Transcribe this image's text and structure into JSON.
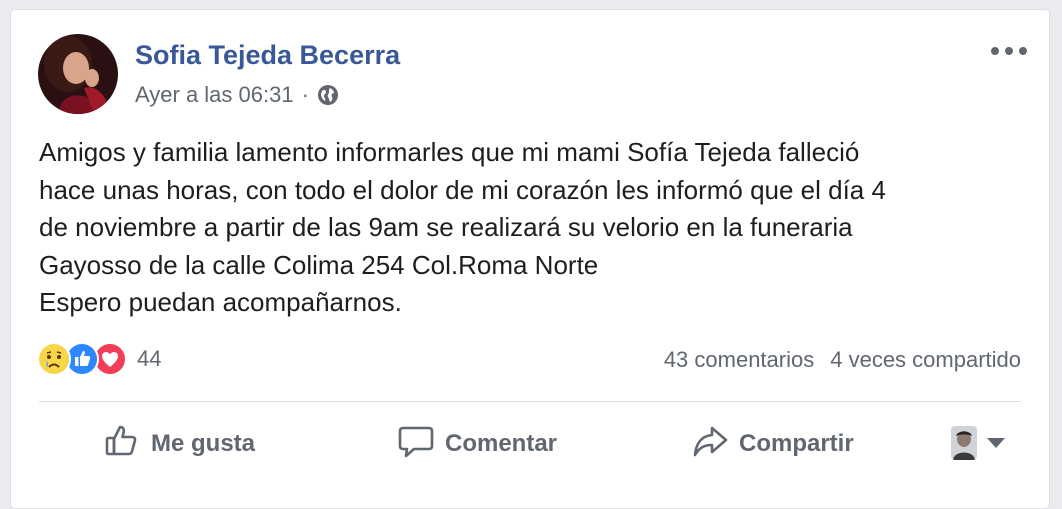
{
  "post": {
    "author": "Sofia Tejeda Becerra",
    "timestamp": "Ayer a las 06:31",
    "separator": "·",
    "audience_icon": "globe-icon",
    "text_lines": [
      "Amigos y familia lamento informarles que mi mami Sofía Tejeda falleció",
      "hace unas horas, con todo el dolor de mi corazón les informó que el día 4",
      "de noviembre a partir de las 9am se realizará su velorio en la funeraria",
      "Gayosso de la calle Colima 254 Col.Roma Norte",
      "Espero puedan acompañarnos."
    ]
  },
  "reactions": {
    "icons": [
      "sad-icon",
      "like-icon",
      "love-icon"
    ],
    "count": "44"
  },
  "stats": {
    "comments": "43 comentarios",
    "shares": "4 veces compartido"
  },
  "actions": {
    "like": "Me gusta",
    "comment": "Comentar",
    "share": "Compartir"
  },
  "colors": {
    "author": "#385898",
    "secondary_text": "#606770",
    "like_blue": "#2d88ff",
    "love_red": "#f33e58",
    "sad_yellow": "#f7d64a"
  }
}
